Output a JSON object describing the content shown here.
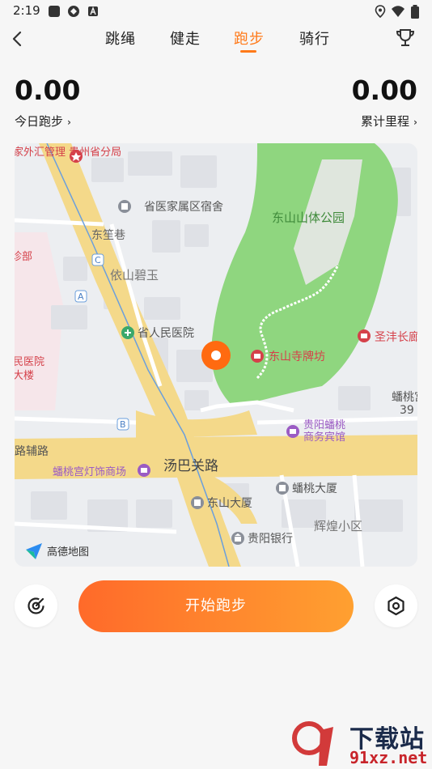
{
  "status_bar": {
    "time": "2:19"
  },
  "nav": {
    "tabs": [
      {
        "label": "跳绳"
      },
      {
        "label": "健走"
      },
      {
        "label": "跑步",
        "active": true
      },
      {
        "label": "骑行"
      }
    ]
  },
  "stats": {
    "today": {
      "value": "0.00",
      "label": "今日跑步"
    },
    "total": {
      "value": "0.00",
      "label": "累计里程"
    }
  },
  "map": {
    "labels": {
      "police": "家外汇管理 贵州省分局",
      "dorm": "省医家属区宿舍",
      "dongli": "东笙巷",
      "yishan": "依山碧玉",
      "park": "东山山体公园",
      "hospital": "省人民医院",
      "dongsi": "东山寺牌坊",
      "shengfeng": "圣沣长廊",
      "hotel1": "贵阳蟠桃",
      "hotel2": "商务宾馆",
      "tangba": "汤巴关路",
      "fulu": "路辅路",
      "lamp": "蟠桃宫灯饰商场",
      "pantao_tower": "蟠桃大厦",
      "dongshan_tower": "东山大厦",
      "guiyang_bank": "贵阳银行",
      "huihuang": "辉煌小区",
      "left_hosp1": "民医院",
      "left_hosp2": "大楼",
      "left_dept": "诊部",
      "pantao_right": "蟠桃宫",
      "num39": "39",
      "marker_c": "C",
      "marker_a": "A",
      "marker_b": "B",
      "brand": "高德地图"
    }
  },
  "actions": {
    "start_label": "开始跑步"
  },
  "watermark": {
    "text": "下载站",
    "url": "91xz.net"
  },
  "colors": {
    "accent": "#ff7a1a",
    "park": "#8fd67f",
    "road": "#f4d98a"
  }
}
